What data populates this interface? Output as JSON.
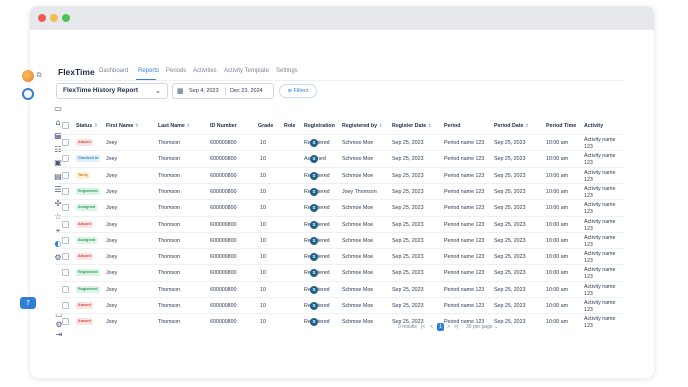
{
  "app": {
    "brand": "FlexTime"
  },
  "tabs": [
    {
      "label": "Dashboard"
    },
    {
      "label": "Reports"
    },
    {
      "label": "Periods"
    },
    {
      "label": "Activities"
    },
    {
      "label": "Activity Template"
    },
    {
      "label": "Settings"
    }
  ],
  "active_tab": "Reports",
  "controls": {
    "report_select": "FlexTime History Report",
    "date_start": "Sep 4, 2023",
    "date_end": "Dec 23, 2024",
    "filters_label": "Filters"
  },
  "table": {
    "columns": [
      "Status",
      "First Name",
      "Last Name",
      "ID Number",
      "Grade",
      "Role",
      "Registration",
      "Registered by",
      "Register Date",
      "Period",
      "Period Date",
      "Period Time",
      "Activity"
    ],
    "rows": [
      {
        "status": "Absent",
        "first": "Joey",
        "last": "Thomson",
        "id": "600000800",
        "grade": "10",
        "role": "S",
        "registration": "Registered",
        "by": "Schmoe Moe",
        "reg_date": "Sep 25, 2023",
        "period": "Period name 123",
        "period_date": "Sep 25, 2023",
        "time": "10:00 am",
        "activity": "Activity name 123"
      },
      {
        "status": "Checked in",
        "first": "Joey",
        "last": "Thomson",
        "id": "600000800",
        "grade": "10",
        "role": "S",
        "registration": "Assigned",
        "by": "Schmoe Moe",
        "reg_date": "Sep 25, 2023",
        "period": "Period name 123",
        "period_date": "Sep 25, 2023",
        "time": "10:00 am",
        "activity": "Activity name 123"
      },
      {
        "status": "Tardy",
        "first": "Joey",
        "last": "Thomson",
        "id": "600000800",
        "grade": "10",
        "role": "S",
        "registration": "Registered",
        "by": "Schmoe Moe",
        "reg_date": "Sep 25, 2023",
        "period": "Period name 123",
        "period_date": "Sep 25, 2023",
        "time": "10:00 am",
        "activity": "Activity name 123"
      },
      {
        "status": "Registered",
        "first": "Joey",
        "last": "Thomson",
        "id": "600000800",
        "grade": "10",
        "role": "S",
        "registration": "Registered",
        "by": "Joey Thomson",
        "reg_date": "Sep 25, 2023",
        "period": "Period name 123",
        "period_date": "Sep 25, 2023",
        "time": "10:00 am",
        "activity": "Activity name 123"
      },
      {
        "status": "Assigned",
        "first": "Joey",
        "last": "Thomson",
        "id": "600000800",
        "grade": "10",
        "role": "S",
        "registration": "Registered",
        "by": "Schmoe Moe",
        "reg_date": "Sep 25, 2023",
        "period": "Period name 123",
        "period_date": "Sep 25, 2023",
        "time": "10:00 am",
        "activity": "Activity name 123"
      },
      {
        "status": "Absent",
        "first": "Joey",
        "last": "Thomson",
        "id": "600000800",
        "grade": "10",
        "role": "S",
        "registration": "Registered",
        "by": "Schmoe Moe",
        "reg_date": "Sep 25, 2023",
        "period": "Period name 123",
        "period_date": "Sep 25, 2023",
        "time": "10:00 am",
        "activity": "Activity name 123"
      },
      {
        "status": "Assigned",
        "first": "Joey",
        "last": "Thomson",
        "id": "600000800",
        "grade": "10",
        "role": "S",
        "registration": "Registered",
        "by": "Schmoe Moe",
        "reg_date": "Sep 25, 2023",
        "period": "Period name 123",
        "period_date": "Sep 25, 2023",
        "time": "10:00 am",
        "activity": "Activity name 123"
      },
      {
        "status": "Absent",
        "first": "Joey",
        "last": "Thomson",
        "id": "600000800",
        "grade": "10",
        "role": "S",
        "registration": "Registered",
        "by": "Schmoe Moe",
        "reg_date": "Sep 25, 2023",
        "period": "Period name 123",
        "period_date": "Sep 25, 2023",
        "time": "10:00 am",
        "activity": "Activity name 123"
      },
      {
        "status": "Registered",
        "first": "Joey",
        "last": "Thomson",
        "id": "600000800",
        "grade": "10",
        "role": "S",
        "registration": "Registered",
        "by": "Schmoe Moe",
        "reg_date": "Sep 25, 2023",
        "period": "Period name 123",
        "period_date": "Sep 25, 2023",
        "time": "10:00 am",
        "activity": "Activity name 123"
      },
      {
        "status": "Registered",
        "first": "Joey",
        "last": "Thomson",
        "id": "600000800",
        "grade": "10",
        "role": "S",
        "registration": "Registered",
        "by": "Schmoe Moe",
        "reg_date": "Sep 25, 2023",
        "period": "Period name 123",
        "period_date": "Sep 25, 2023",
        "time": "10:00 am",
        "activity": "Activity name 123"
      },
      {
        "status": "Absent",
        "first": "Joey",
        "last": "Thomson",
        "id": "600000800",
        "grade": "10",
        "role": "S",
        "registration": "Registered",
        "by": "Schmoe Moe",
        "reg_date": "Sep 25, 2023",
        "period": "Period name 123",
        "period_date": "Sep 25, 2023",
        "time": "10:00 am",
        "activity": "Activity name 123"
      },
      {
        "status": "Absent",
        "first": "Joey",
        "last": "Thomson",
        "id": "600000800",
        "grade": "10",
        "role": "S",
        "registration": "Registered",
        "by": "Schmoe Moe",
        "reg_date": "Sep 25, 2023",
        "period": "Period name 123",
        "period_date": "Sep 25, 2023",
        "time": "10:00 am",
        "activity": "Activity name 123"
      }
    ]
  },
  "status_colors": {
    "Absent": {
      "bg": "#fde3e3",
      "fg": "#d9473f"
    },
    "Checked in": {
      "bg": "#dff0fb",
      "fg": "#2a7fc0"
    },
    "Tardy": {
      "bg": "#fdf0d8",
      "fg": "#c98a1b"
    },
    "Registered": {
      "bg": "#dcf4e6",
      "fg": "#2f9a5c"
    },
    "Assigned": {
      "bg": "#dcf4e6",
      "fg": "#2f9a5c"
    }
  },
  "pagination": {
    "results": "0 results",
    "first": "|<",
    "prev": "<",
    "current": "1",
    "next": ">",
    "last": ">|",
    "per_page": "30 per page"
  },
  "sidebar_icons": [
    "video-icon",
    "building-icon",
    "calendar-icon",
    "users-icon",
    "id-card-icon",
    "clipboard-icon",
    "list-icon",
    "puzzle-icon",
    "star-icon",
    "location-icon",
    "theme-icon",
    "settings-icon"
  ],
  "accent": "#2f7fd8"
}
